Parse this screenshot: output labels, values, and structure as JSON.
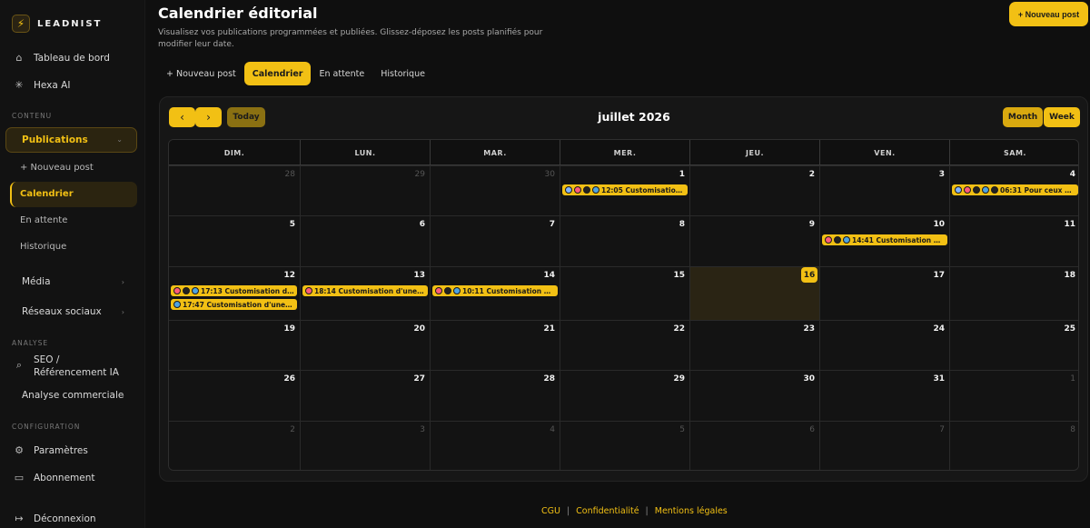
{
  "brand": {
    "name": "LEADNIST"
  },
  "sidebar": {
    "top_items": [
      {
        "label": "Tableau de bord",
        "icon": "home-icon"
      },
      {
        "label": "Hexa AI",
        "icon": "sparkle-icon"
      }
    ],
    "section_contenu": "CONTENU",
    "publications": {
      "label": "Publications",
      "expanded": true
    },
    "publication_subitems": [
      "+ Nouveau post",
      "Calendrier",
      "En attente",
      "Historique"
    ],
    "active_subitem": "Calendrier",
    "media": "Média",
    "social": "Réseaux sociaux",
    "section_analyse": "ANALYSE",
    "seo": "SEO / Référencement IA",
    "commercial": "Analyse commerciale",
    "section_config": "CONFIGURATION",
    "settings": "Paramètres",
    "subscription": "Abonnement",
    "logout": "Déconnexion"
  },
  "header": {
    "title": "Calendrier éditorial",
    "subtitle": "Visualisez vos publications programmées et publiées. Glissez-déposez les posts planifiés pour modifier leur date.",
    "new_post_button": "+ Nouveau post"
  },
  "tabs": [
    {
      "label": "+ Nouveau post",
      "active": false
    },
    {
      "label": "Calendrier",
      "active": true
    },
    {
      "label": "En attente",
      "active": false
    },
    {
      "label": "Historique",
      "active": false
    }
  ],
  "calendar": {
    "prev_icon": "chevron-left-icon",
    "next_icon": "chevron-right-icon",
    "today_label": "Today",
    "month_title": "juillet 2026",
    "views": [
      {
        "label": "Month",
        "selected": true
      },
      {
        "label": "Week",
        "selected": false
      }
    ],
    "weekdays": [
      "DIM.",
      "LUN.",
      "MAR.",
      "MER.",
      "JEU.",
      "VEN.",
      "SAM."
    ],
    "weeks": [
      [
        {
          "day": "28",
          "out": true
        },
        {
          "day": "29",
          "out": true
        },
        {
          "day": "30",
          "out": true
        },
        {
          "day": "1",
          "events": [
            {
              "text": "12:05 Customisation d'…",
              "icons": [
                "#7fb3ff",
                "#ff5b7a",
                "#222222",
                "#4fa3e0"
              ]
            }
          ]
        },
        {
          "day": "2"
        },
        {
          "day": "3"
        },
        {
          "day": "4",
          "events": [
            {
              "text": "06:31 Pour ceux qui…",
              "icons": [
                "#7fb3ff",
                "#ff5b7a",
                "#222222",
                "#4fa3e0",
                "#222222"
              ]
            }
          ]
        }
      ],
      [
        {
          "day": "5"
        },
        {
          "day": "6"
        },
        {
          "day": "7"
        },
        {
          "day": "8"
        },
        {
          "day": "9"
        },
        {
          "day": "10",
          "events": [
            {
              "text": "14:41 Customisation d'un…",
              "icons": [
                "#ff5b7a",
                "#222222",
                "#4fa3e0"
              ]
            }
          ]
        },
        {
          "day": "11"
        }
      ],
      [
        {
          "day": "12",
          "events": [
            {
              "text": "17:13 Customisation d'un…",
              "icons": [
                "#ff5b7a",
                "#222222",
                "#4fa3e0"
              ]
            },
            {
              "text": "17:47 Customisation d'une sell…",
              "icons": [
                "#4fa3e0"
              ]
            }
          ]
        },
        {
          "day": "13",
          "events": [
            {
              "text": "18:14 Customisation d'une sell…",
              "icons": [
                "#ff5b7a"
              ]
            }
          ]
        },
        {
          "day": "14",
          "events": [
            {
              "text": "10:11 Customisation d'un…",
              "icons": [
                "#ff5b7a",
                "#222222",
                "#4fa3e0"
              ]
            }
          ]
        },
        {
          "day": "15"
        },
        {
          "day": "16",
          "today": true
        },
        {
          "day": "17"
        },
        {
          "day": "18"
        }
      ],
      [
        {
          "day": "19"
        },
        {
          "day": "20"
        },
        {
          "day": "21"
        },
        {
          "day": "22"
        },
        {
          "day": "23"
        },
        {
          "day": "24"
        },
        {
          "day": "25"
        }
      ],
      [
        {
          "day": "26"
        },
        {
          "day": "27"
        },
        {
          "day": "28"
        },
        {
          "day": "29"
        },
        {
          "day": "30"
        },
        {
          "day": "31"
        },
        {
          "day": "1",
          "out": true
        }
      ],
      [
        {
          "day": "2",
          "out": true
        },
        {
          "day": "3",
          "out": true
        },
        {
          "day": "4",
          "out": true
        },
        {
          "day": "5",
          "out": true
        },
        {
          "day": "6",
          "out": true
        },
        {
          "day": "7",
          "out": true
        },
        {
          "day": "8",
          "out": true
        }
      ]
    ]
  },
  "footer": {
    "links": [
      "CGU",
      "Confidentialité",
      "Mentions légales"
    ],
    "separator": "|"
  },
  "colors": {
    "accent": "#f2c014",
    "background": "#0f0f0f"
  }
}
